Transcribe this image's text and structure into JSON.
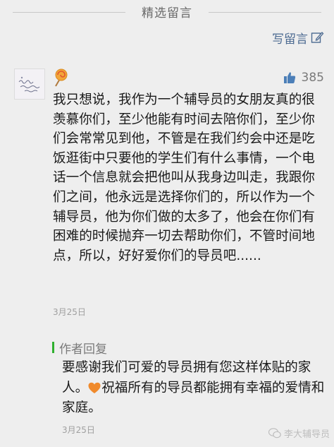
{
  "section": {
    "title": "精选留言"
  },
  "write_comment": {
    "label": "写留言",
    "icon": "pencil-icon"
  },
  "comment": {
    "avatar_icon": "avatar-image",
    "badge_icon": "lollipop-icon",
    "likes": "385",
    "text": "我只想说，我作为一个辅导员的女朋友真的很羡慕你们，至少他能有时间去陪你们，至少你们会常常见到他，不管是在我们约会中还是吃饭逛街中只要他的学生们有什么事情，一个电话一个信息就会把他叫从我身边叫走，我跟你们之间，他永远是选择你们的，所以作为一个辅导员，他为你们做的太多了，他会在你们有困难的时候抛弃一切去帮助你们，不管时间地点，所以，好好爱你们的导员吧......",
    "date": "3月25日"
  },
  "reply": {
    "label": "作者回复",
    "text_before": "要感谢我们可爱的导员拥有您这样体贴的家人。",
    "text_after": "祝福所有的导员都能拥有幸福的爱情和家庭。",
    "date": "3月25日",
    "accent": "#2fb02f"
  },
  "watermark": {
    "label": "李大辅导员"
  }
}
